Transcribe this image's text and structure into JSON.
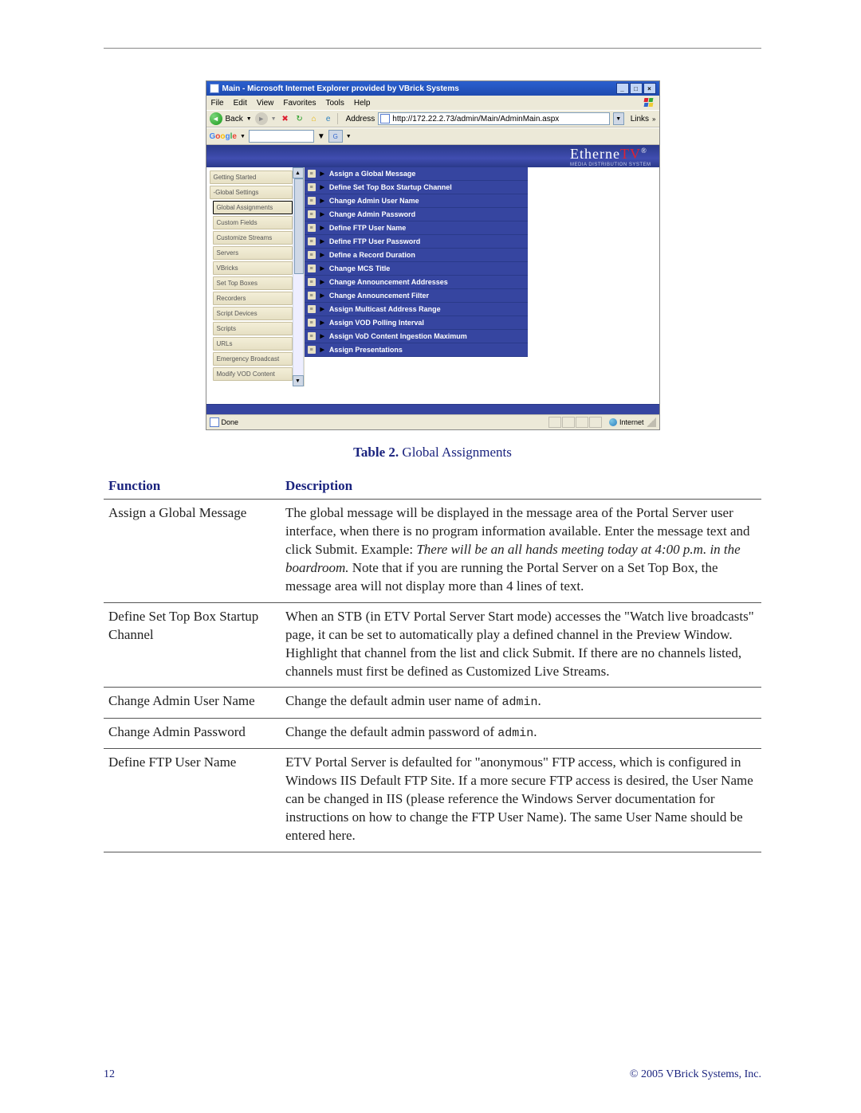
{
  "browser": {
    "title": "Main - Microsoft Internet Explorer provided by VBrick Systems",
    "menus": [
      "File",
      "Edit",
      "View",
      "Favorites",
      "Tools",
      "Help"
    ],
    "back_label": "Back",
    "address_label": "Address",
    "address_url": "http://172.22.2.73/admin/Main/AdminMain.aspx",
    "links_label": "Links",
    "google_label": "Google",
    "status_done": "Done",
    "status_zone": "Internet"
  },
  "brand": {
    "name": "EtherneTV",
    "sub": "MEDIA DISTRIBUTION SYSTEM"
  },
  "sidebar": {
    "items": [
      {
        "label": "Getting Started",
        "level": 0,
        "selected": false
      },
      {
        "label": "-Global Settings",
        "level": 0,
        "selected": false
      },
      {
        "label": "Global Assignments",
        "level": 1,
        "selected": true
      },
      {
        "label": "Custom Fields",
        "level": 1,
        "selected": false
      },
      {
        "label": "Customize Streams",
        "level": 1,
        "selected": false
      },
      {
        "label": "Servers",
        "level": 1,
        "selected": false
      },
      {
        "label": "VBricks",
        "level": 1,
        "selected": false
      },
      {
        "label": "Set Top Boxes",
        "level": 1,
        "selected": false
      },
      {
        "label": "Recorders",
        "level": 1,
        "selected": false
      },
      {
        "label": "Script Devices",
        "level": 1,
        "selected": false
      },
      {
        "label": "Scripts",
        "level": 1,
        "selected": false
      },
      {
        "label": "URLs",
        "level": 1,
        "selected": false
      },
      {
        "label": "Emergency Broadcast",
        "level": 1,
        "selected": false
      },
      {
        "label": "Modify VOD Content",
        "level": 1,
        "selected": false
      }
    ]
  },
  "assignments": [
    "Assign a Global Message",
    "Define Set Top Box Startup Channel",
    "Change Admin User Name",
    "Change Admin Password",
    "Define FTP User Name",
    "Define FTP User Password",
    "Define a Record Duration",
    "Change MCS Title",
    "Change Announcement Addresses",
    "Change Announcement Filter",
    "Assign Multicast Address Range",
    "Assign VOD Polling Interval",
    "Assign VoD Content Ingestion Maximum",
    "Assign Presentations"
  ],
  "caption": {
    "bold": "Table 2.",
    "rest": "  Global Assignments"
  },
  "table": {
    "head": {
      "fn": "Function",
      "desc": "Description"
    },
    "rows": [
      {
        "fn": "Assign a Global Message",
        "desc_pre": "The global message will be displayed in the message area of the Portal Server user interface, when there is no program information available. Enter the message text and click Submit. Example: ",
        "desc_ital": "There will be an all hands meeting today at 4:00 p.m. in the boardroom.",
        "desc_post": " Note that if you are running the Portal Server on a Set Top Box, the message area will not display more than 4 lines of text."
      },
      {
        "fn": "Define Set Top Box Startup Channel",
        "desc_pre": "When an STB (in ETV Portal Server Start mode) accesses the \"Watch live broadcasts\" page, it can be set to automatically play a defined channel in the Preview Window. Highlight that channel from the list and click Submit. If there are no channels listed, channels must first be defined as Customized Live Streams.",
        "desc_ital": "",
        "desc_post": ""
      },
      {
        "fn": "Change Admin User Name",
        "desc_pre": "Change the default admin user name of ",
        "mono": "admin",
        "desc_post": "."
      },
      {
        "fn": "Change Admin Password",
        "desc_pre": "Change the default admin password of ",
        "mono": "admin",
        "desc_post": "."
      },
      {
        "fn": "Define FTP User Name",
        "desc_pre": "ETV Portal Server is defaulted for \"anonymous\" FTP access, which is configured in Windows IIS Default FTP Site. If a more secure FTP access is desired, the User Name can be changed in IIS (please reference the Windows Server documentation for instructions on how to change the FTP User Name).  The same User Name should be entered here.",
        "desc_ital": "",
        "desc_post": ""
      }
    ]
  },
  "footer": {
    "page": "12",
    "copyright": "© 2005 VBrick Systems, Inc."
  }
}
